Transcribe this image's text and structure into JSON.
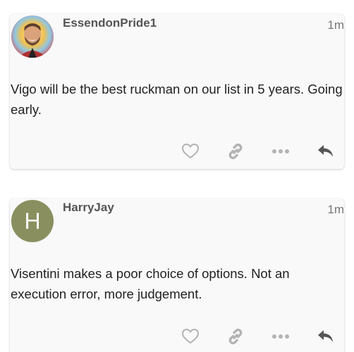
{
  "posts": [
    {
      "username": "EssendonPride1",
      "time": "1m",
      "body": "Vigo will be the best ruckman on our list in 5 years. Going early.",
      "avatar": {
        "type": "photo",
        "colors": [
          "#f2c14e",
          "#5ab0d8",
          "#d94b4b"
        ]
      }
    },
    {
      "username": "HarryJay",
      "time": "1m",
      "body": "Visentini makes a poor choice of options. Not an execution error, more judgement.",
      "avatar": {
        "type": "letter",
        "letter": "H",
        "color": "#8a8f5f"
      }
    }
  ],
  "actions": {
    "like_icon": "heart-icon",
    "link_icon": "link-icon",
    "more_icon": "ellipsis-icon",
    "reply_icon": "reply-icon",
    "icon_color_light": "#b3b3b3",
    "icon_color_dark": "#555555"
  }
}
